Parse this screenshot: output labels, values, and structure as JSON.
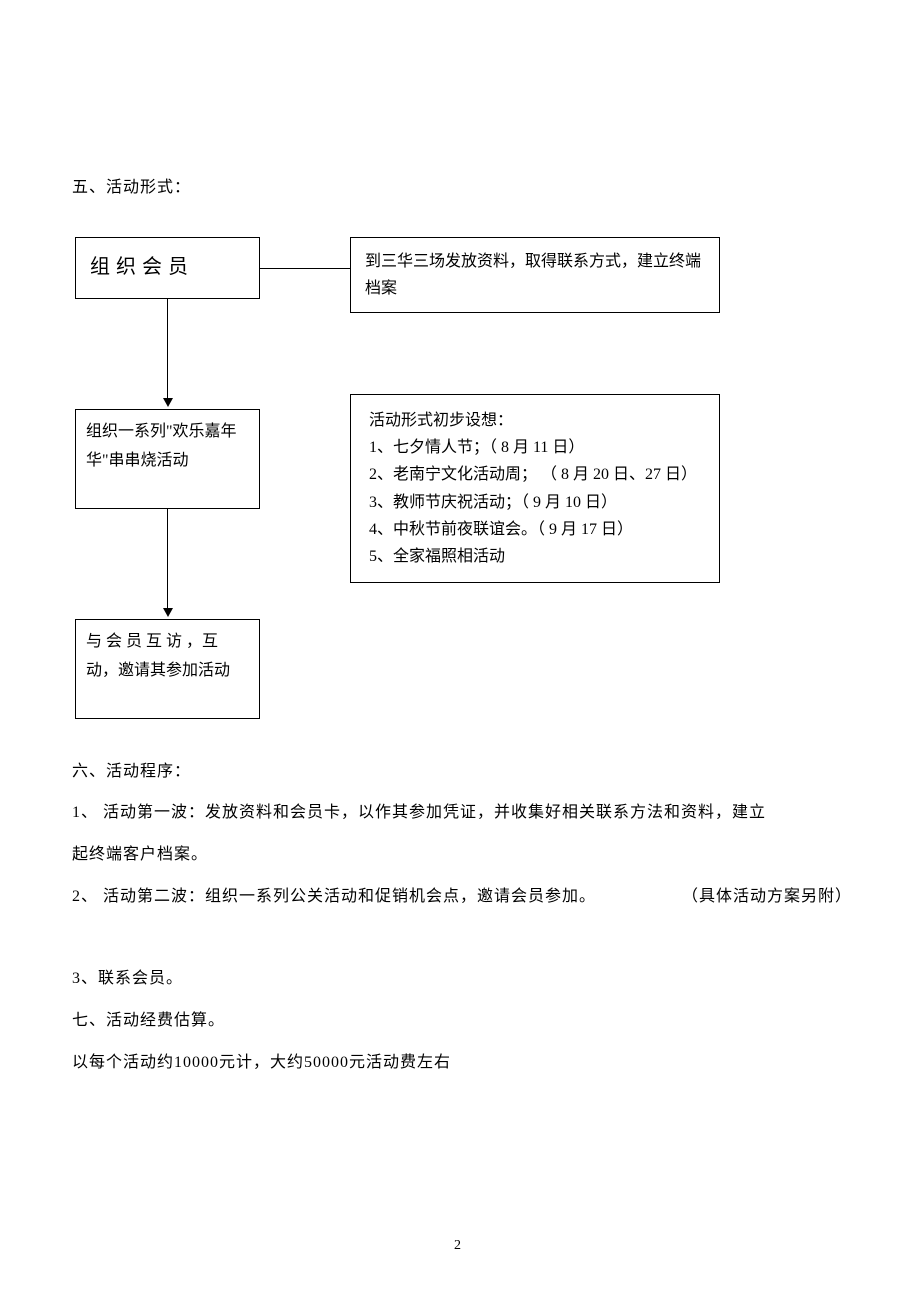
{
  "section5": {
    "title": "五、活动形式：",
    "box1": "组织会员",
    "box1_right": "到三华三场发放资料，取得联系方式，建立终端档案",
    "box2": "组织一系列\"欢乐嘉年华\"串串烧活动",
    "box2_right_title": "活动形式初步设想：",
    "box2_right_items": [
      "1、七夕情人节；（ 8 月 11 日）",
      "2、老南宁文化活动周；  （ 8 月 20 日、27 日）",
      "3、教师节庆祝活动；（ 9 月 10 日）",
      "4、中秋节前夜联谊会。（ 9 月 17 日）",
      "5、全家福照相活动"
    ],
    "box3": "与 会 员 互 访 ，互动，邀请其参加活动"
  },
  "section6": {
    "title": "六、活动程序：",
    "item1_a": "1、 活动第一波：发放资料和会员卡，以作其参加凭证，并收集好相关联系方法和资料，建立",
    "item1_b": "起终端客户档案。",
    "item2": "2、 活动第二波：组织一系列公关活动和促销机会点，邀请会员参加。",
    "item2_note": "（具体活动方案另附）",
    "item3": "3、联系会员。"
  },
  "section7": {
    "title": "七、活动经费估算。",
    "body": "以每个活动约10000元计，大约50000元活动费左右"
  },
  "page_number": "2"
}
